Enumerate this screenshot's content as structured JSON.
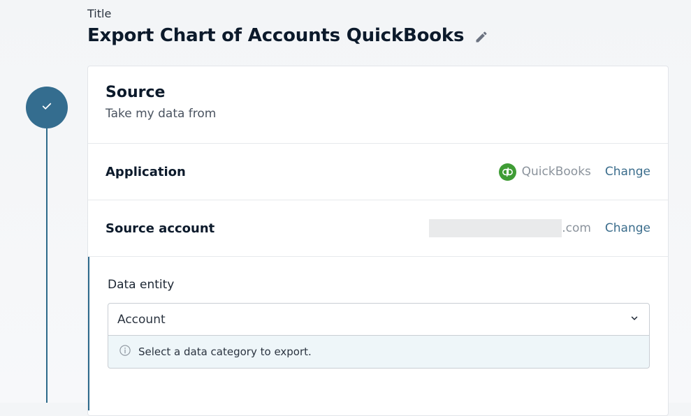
{
  "header": {
    "label": "Title",
    "title": "Export Chart of Accounts QuickBooks",
    "edit_icon": "pencil-icon"
  },
  "step": {
    "status_icon": "check-icon",
    "color": "#346d8f"
  },
  "source": {
    "title": "Source",
    "subtitle": "Take my data from",
    "application": {
      "label": "Application",
      "app_name": "QuickBooks",
      "app_icon": "quickbooks-logo",
      "change_label": "Change"
    },
    "account": {
      "label": "Source account",
      "value_suffix": ".com",
      "change_label": "Change"
    },
    "entity": {
      "label": "Data entity",
      "selected": "Account",
      "hint": "Select a data category to export.",
      "hint_icon": "info-icon",
      "dropdown_icon": "chevron-down-icon"
    }
  },
  "colors": {
    "accent": "#346d8f",
    "link": "#3b6d8c",
    "quickbooks_green": "#3f9c35",
    "hint_background": "#eef6f9"
  }
}
